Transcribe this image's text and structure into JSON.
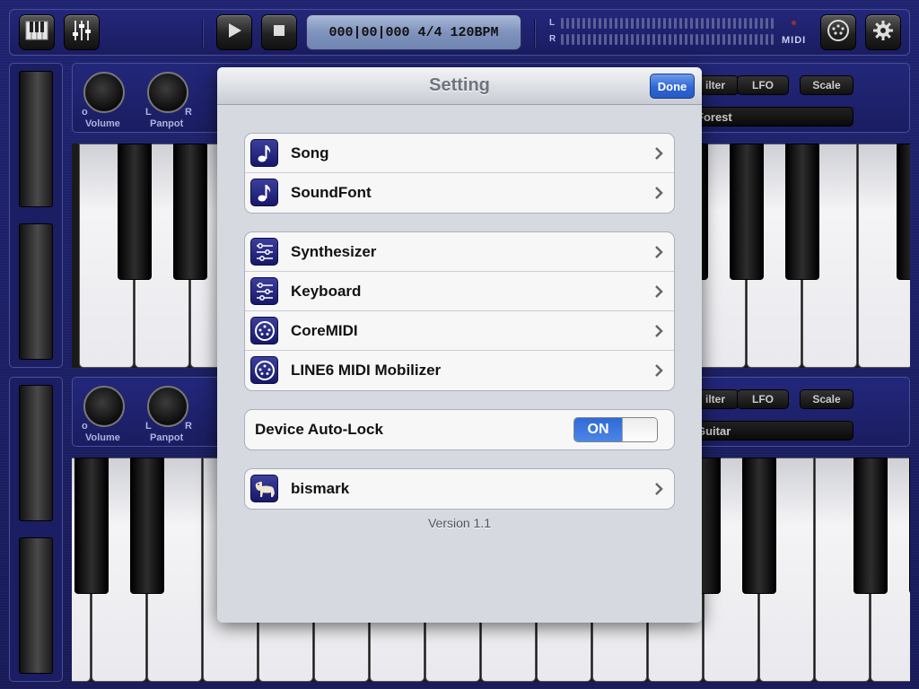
{
  "transport": {
    "display": "000|00|000 4/4 120BPM",
    "meter_left_label": "L",
    "meter_right_label": "R",
    "midi_label": "MIDI"
  },
  "toolbar_icons": [
    "piano-icon",
    "mixer-icon",
    "play-icon",
    "stop-icon",
    "midi-port-icon",
    "gear-icon"
  ],
  "upper_panel": {
    "volume_label": "Volume",
    "panpot_label": "Panpot",
    "knob_min_label": "o",
    "pan_left_label": "L",
    "pan_right_label": "R",
    "filter_label": "ilter",
    "lfo_label": "LFO",
    "scale_label": "Scale",
    "instrument_name": "Forest"
  },
  "lower_panel": {
    "volume_label": "Volume",
    "panpot_label": "Panpot",
    "knob_min_label": "o",
    "pan_left_label": "L",
    "pan_right_label": "R",
    "filter_label": "ilter",
    "lfo_label": "LFO",
    "scale_label": "Scale",
    "instrument_name": "Guitar"
  },
  "dialog": {
    "title": "Setting",
    "done_label": "Done",
    "groups": [
      [
        {
          "label": "Song",
          "icon": "music-note-icon"
        },
        {
          "label": "SoundFont",
          "icon": "music-note-icon"
        }
      ],
      [
        {
          "label": "Synthesizer",
          "icon": "sliders-icon"
        },
        {
          "label": "Keyboard",
          "icon": "sliders-icon"
        },
        {
          "label": "CoreMIDI",
          "icon": "midi-port-icon"
        },
        {
          "label": "LINE6 MIDI Mobilizer",
          "icon": "midi-port-icon"
        }
      ]
    ],
    "auto_lock": {
      "label": "Device Auto-Lock",
      "state": "ON"
    },
    "profile": {
      "label": "bismark",
      "icon": "dog-icon"
    },
    "version": "Version 1.1"
  }
}
